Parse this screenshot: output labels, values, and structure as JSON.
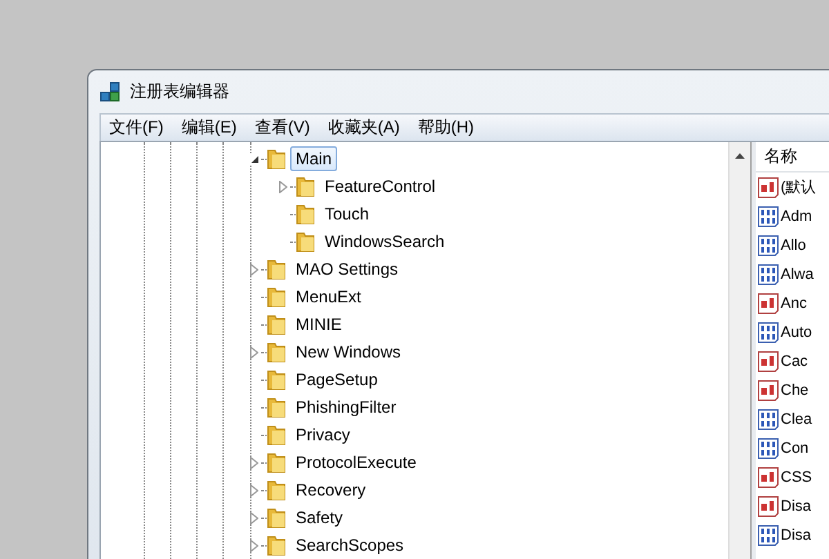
{
  "window": {
    "title": "注册表编辑器"
  },
  "menu": [
    "文件(F)",
    "编辑(E)",
    "查看(V)",
    "收藏夹(A)",
    "帮助(H)"
  ],
  "tree": [
    {
      "label": "Main",
      "selected": true,
      "expandable": true,
      "expanded": true,
      "children": [
        {
          "label": "FeatureControl",
          "selected": false,
          "expandable": true,
          "expanded": false
        },
        {
          "label": "Touch",
          "selected": false,
          "expandable": false
        },
        {
          "label": "WindowsSearch",
          "selected": false,
          "expandable": false
        }
      ]
    },
    {
      "label": "MAO Settings",
      "selected": false,
      "expandable": true,
      "expanded": false
    },
    {
      "label": "MenuExt",
      "selected": false,
      "expandable": false
    },
    {
      "label": "MINIE",
      "selected": false,
      "expandable": false
    },
    {
      "label": "New Windows",
      "selected": false,
      "expandable": true,
      "expanded": false
    },
    {
      "label": "PageSetup",
      "selected": false,
      "expandable": false
    },
    {
      "label": "PhishingFilter",
      "selected": false,
      "expandable": false
    },
    {
      "label": "Privacy",
      "selected": false,
      "expandable": false
    },
    {
      "label": "ProtocolExecute",
      "selected": false,
      "expandable": true,
      "expanded": false
    },
    {
      "label": "Recovery",
      "selected": false,
      "expandable": true,
      "expanded": false
    },
    {
      "label": "Safety",
      "selected": false,
      "expandable": true,
      "expanded": false
    },
    {
      "label": "SearchScopes",
      "selected": false,
      "expandable": true,
      "expanded": false
    }
  ],
  "values": {
    "column": "名称",
    "rows": [
      {
        "name": "(默认",
        "kind": "string"
      },
      {
        "name": "Adm",
        "kind": "binary"
      },
      {
        "name": "Allo",
        "kind": "binary"
      },
      {
        "name": "Alwa",
        "kind": "binary"
      },
      {
        "name": "Anc",
        "kind": "string"
      },
      {
        "name": "Auto",
        "kind": "binary"
      },
      {
        "name": "Cac",
        "kind": "string"
      },
      {
        "name": "Che",
        "kind": "string"
      },
      {
        "name": "Clea",
        "kind": "binary"
      },
      {
        "name": "Con",
        "kind": "binary"
      },
      {
        "name": "CSS",
        "kind": "string"
      },
      {
        "name": "Disa",
        "kind": "string"
      },
      {
        "name": "Disa",
        "kind": "binary"
      }
    ]
  }
}
